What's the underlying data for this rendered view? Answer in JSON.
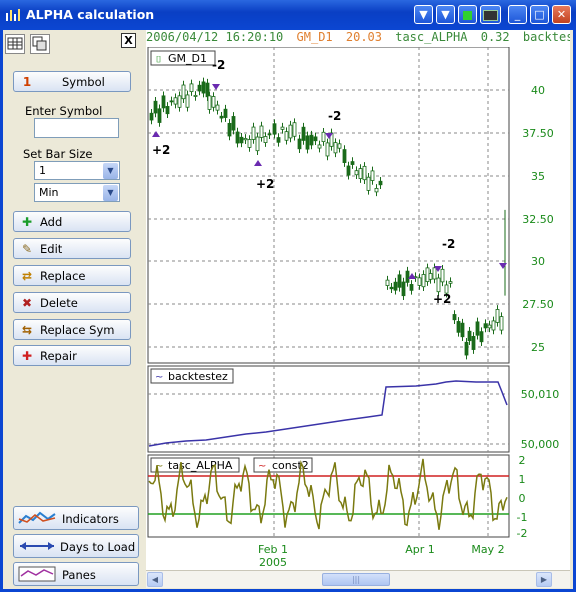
{
  "window": {
    "title": "ALPHA calculation"
  },
  "titlebar_buttons": [
    "chevron-down",
    "chevron-down",
    "green-square",
    "chart",
    "minimize",
    "maximize",
    "close"
  ],
  "info_bar": {
    "datetime": "2006/04/12 16:20:10",
    "symbol": "GM_D1",
    "symbol_value": "20.03",
    "indicator": "tasc_ALPHA",
    "indicator_value": "0.32",
    "extra": "backtest"
  },
  "sidebar": {
    "symbol_button": "Symbol",
    "enter_symbol_label": "Enter Symbol",
    "enter_symbol_value": "",
    "bar_size_label": "Set Bar Size",
    "bar_size_value": "1",
    "bar_unit_value": "Min",
    "buttons": [
      "Add",
      "Edit",
      "Replace",
      "Delete",
      "Replace Sym",
      "Repair"
    ],
    "bottom_buttons": [
      "Indicators",
      "Days to Load",
      "Panes"
    ],
    "close_label": "X"
  },
  "colors": {
    "up": "#1a9c2a",
    "down": "#1a6b1a",
    "signal_up": "#6a2ab0",
    "equity": "#3a33a8",
    "alpha": "#7a7a10",
    "upper": "#d02020",
    "lower": "#20a020",
    "axis_text": "#1a8a1a"
  },
  "pane1": {
    "label": "GM_D1",
    "y_ticks": [
      "40",
      "37.50",
      "35",
      "32.50",
      "30",
      "27.50",
      "25"
    ],
    "annotations": [
      "-2",
      "+2",
      "+2",
      "-2",
      "-2",
      "+2"
    ]
  },
  "pane2": {
    "label": "backtestez",
    "y_ticks": [
      "50,010",
      "50,000"
    ]
  },
  "pane3": {
    "labels": [
      "tasc_ALPHA",
      "const2"
    ],
    "y_ticks": [
      "2",
      "1",
      "0",
      "-1",
      "-2"
    ]
  },
  "x_axis": {
    "ticks": [
      "Feb 1",
      "Apr 1",
      "May 2"
    ],
    "year_label": "2005"
  }
}
